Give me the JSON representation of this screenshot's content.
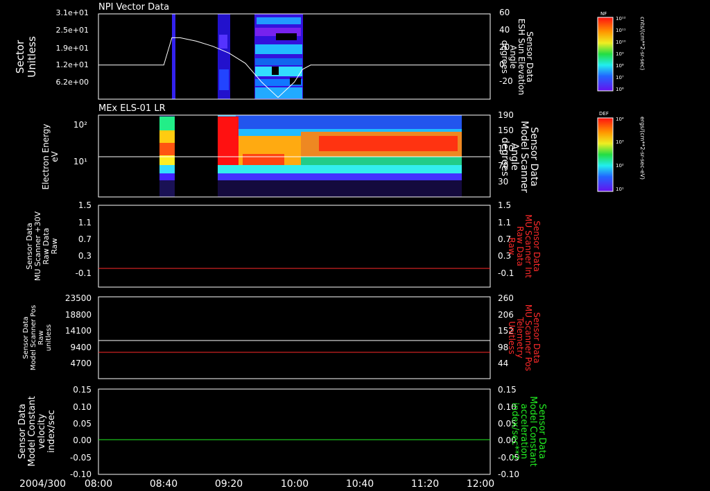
{
  "colors": {
    "background": "#000000",
    "axis": "#ffffff",
    "red": "#ff2a2a",
    "green": "#22ee22"
  },
  "chart_data": [
    {
      "type": "heatmap",
      "title": "NPI Vector Data",
      "ylabel_left": [
        "Sector",
        "Unitless"
      ],
      "yticks_left": [
        "3.1e+01",
        "2.5e+01",
        "1.9e+01",
        "1.2e+01",
        "6.2e+00"
      ],
      "ylabel_right": [
        "Sensor Data",
        "ESH Sun Elevation",
        "Angle",
        "degrees"
      ],
      "yticks_right": [
        "60",
        "40",
        "20",
        "0",
        "-20"
      ],
      "ylim_right": [
        -40,
        60
      ],
      "colorbar": {
        "label": "NF",
        "unit": "cnts/(cm**2-sr-sec)",
        "ticks": [
          "10¹²",
          "10¹¹",
          "10¹⁰",
          "10⁹",
          "10⁸",
          "10⁷",
          "10⁶"
        ]
      },
      "elevation_curve": {
        "x": [
          "08:00",
          "08:40",
          "08:45",
          "08:50",
          "09:00",
          "09:10",
          "09:20",
          "09:30",
          "09:40",
          "09:50",
          "10:00",
          "10:05",
          "10:10",
          "12:00"
        ],
        "y": [
          0,
          0,
          32,
          32,
          28,
          22,
          14,
          2,
          -20,
          -38,
          -20,
          -5,
          0,
          0
        ]
      }
    },
    {
      "type": "heatmap",
      "title": "MEx ELS-01 LR",
      "ylabel_left": [
        "Electron Energy",
        "eV"
      ],
      "yticks_left": [
        "10²",
        "10¹"
      ],
      "ylabel_right": [
        "Sensor Data",
        "Model Scanner",
        "Angle",
        "degrees"
      ],
      "yticks_right": [
        "190",
        "150",
        "110",
        "70",
        "30"
      ],
      "colorbar": {
        "label": "DEF",
        "unit": "ergs/(cm**2-sr-sec-eV)",
        "ticks": [
          "10⁴",
          "10³",
          "10²",
          "10¹"
        ]
      }
    },
    {
      "type": "line",
      "ylabel_left": [
        "Sensor Data",
        "MU Scanner +30V",
        "Raw Data",
        "Raw"
      ],
      "yticks_left": [
        "1.5",
        "1.1",
        "0.7",
        "0.3",
        "-0.1"
      ],
      "ylabel_right": [
        "Sensor Data",
        "MU Scanner Int",
        "Raw Data",
        "Raw"
      ],
      "yticks_right": [
        "1.5",
        "1.1",
        "0.7",
        "0.3",
        "-0.1"
      ],
      "ylim": [
        -0.3,
        1.5
      ],
      "series": [
        {
          "values": [
            0.0
          ]
        }
      ]
    },
    {
      "type": "line",
      "ylabel_left": [
        "Sensor Data",
        "Model Scanner Pos",
        "Raw",
        "unitless"
      ],
      "yticks_left": [
        "23500",
        "18800",
        "14100",
        "9400",
        "4700"
      ],
      "ylabel_right": [
        "Sensor Data",
        "MU Scanner Pos",
        "Telemetry",
        "Unitless"
      ],
      "yticks_right": [
        "260",
        "206",
        "152",
        "98",
        "44"
      ],
      "ylim_left": [
        0,
        23500
      ],
      "series": [
        {
          "values": [
            11400
          ]
        },
        {
          "values": [
            8000
          ]
        }
      ]
    },
    {
      "type": "line",
      "ylabel_left": [
        "Sensor Data",
        "Model Constant",
        "velocity",
        "index/sec"
      ],
      "yticks_left": [
        "0.15",
        "0.10",
        "0.05",
        "0.00",
        "-0.05",
        "-0.10"
      ],
      "ylabel_right": [
        "Sensor Data",
        "Model Constant",
        "acceleration",
        "index/sec**2"
      ],
      "yticks_right": [
        "0.15",
        "0.10",
        "0.05",
        "0.00",
        "-0.05",
        "-0.10"
      ],
      "ylim": [
        -0.1,
        0.15
      ],
      "series": [
        {
          "values": [
            0.0
          ]
        }
      ]
    }
  ],
  "xaxis": {
    "date": "2004/300",
    "ticks": [
      "08:00",
      "08:40",
      "09:20",
      "10:00",
      "10:40",
      "11:20",
      "12:00"
    ]
  }
}
